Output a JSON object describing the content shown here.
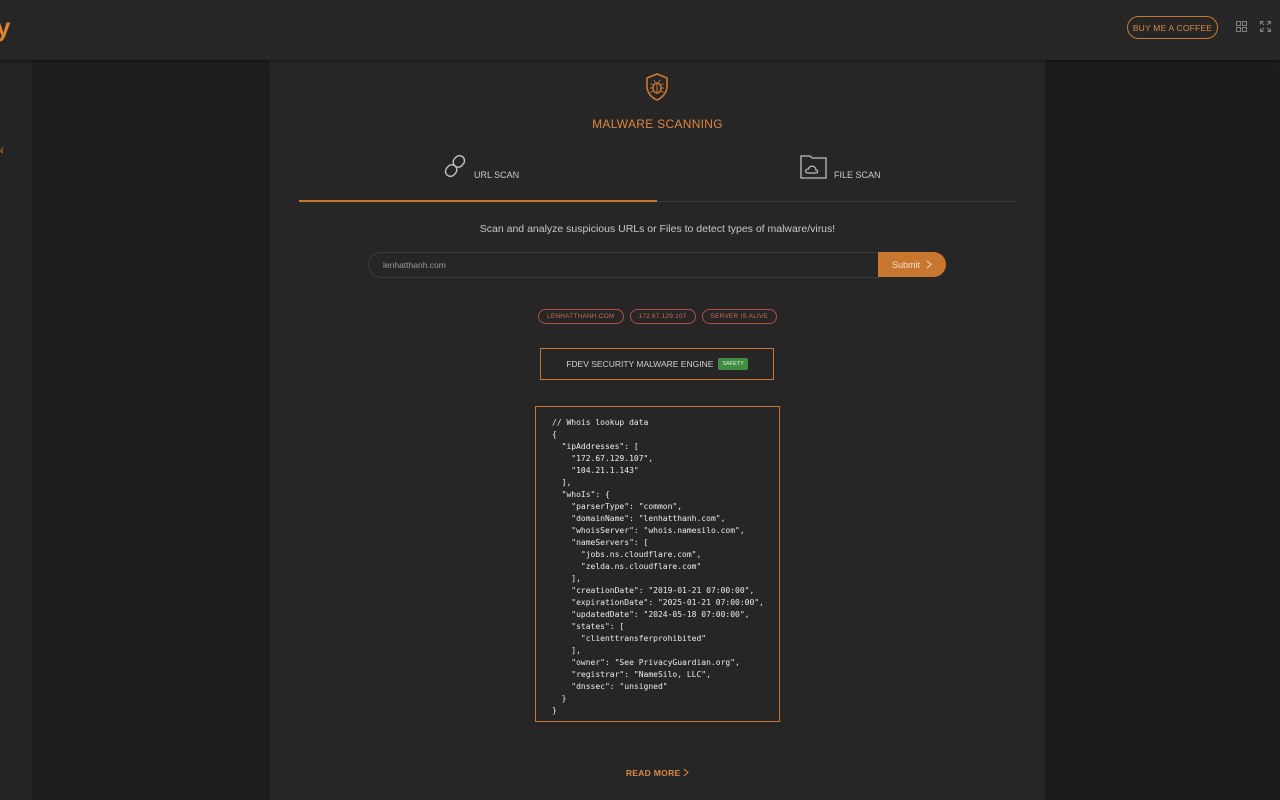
{
  "header": {
    "brand": "y",
    "coffee_label": "BUY ME A COFFEE"
  },
  "sidebar": {
    "item_label": "AN"
  },
  "main": {
    "title": "MALWARE SCANNING",
    "tabs": [
      {
        "label": "URL SCAN",
        "active": true
      },
      {
        "label": "FILE SCAN",
        "active": false
      }
    ],
    "subtitle": "Scan and analyze suspicious URLs or Files to detect types of malware/virus!",
    "search": {
      "value": "lenhatthanh.com",
      "placeholder": ""
    },
    "submit_label": "Submit",
    "badges": [
      "LENHATTHANH.COM",
      "172.67.129.107",
      "SERVER IS ALIVE"
    ],
    "engine": {
      "label": "FDEV SECURITY MALWARE ENGINE",
      "status": "SAFETY"
    },
    "code_lines": [
      "// Whois lookup data",
      "{",
      "  \"ipAddresses\": [",
      "    \"172.67.129.107\",",
      "    \"104.21.1.143\"",
      "  ],",
      "  \"whoIs\": {",
      "    \"parserType\": \"common\",",
      "    \"domainName\": \"lenhatthanh.com\",",
      "    \"whoisServer\": \"whois.namesilo.com\",",
      "    \"nameServers\": [",
      "      \"jobs.ns.cloudflare.com\",",
      "      \"zelda.ns.cloudflare.com\"",
      "    ],",
      "    \"creationDate\": \"2019-01-21 07:00:00\",",
      "    \"expirationDate\": \"2025-01-21 07:00:00\",",
      "    \"updatedDate\": \"2024-05-18 07:00:00\",",
      "    \"states\": [",
      "      \"clienttransferprohibited\"",
      "    ],",
      "    \"owner\": \"See PrivacyGuardian.org\",",
      "    \"registrar\": \"NameSilo, LLC\",",
      "    \"dnssec\": \"unsigned\"",
      "  }",
      "}"
    ],
    "read_more_label": "READ MORE"
  },
  "colors": {
    "accent": "#c9762f",
    "badge_red": "#b24f40",
    "safety_green": "#3e8e41"
  },
  "icons": {
    "title": "shield-bug-icon",
    "url_tab": "link-icon",
    "file_tab": "folder-cloud-icon",
    "submit": "chevron-right-icon",
    "read_more": "chevron-right-icon",
    "header_grid": "grid-icon",
    "header_fullscreen": "fullscreen-icon"
  }
}
